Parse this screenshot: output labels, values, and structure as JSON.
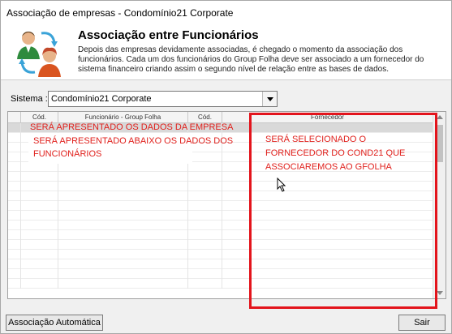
{
  "window": {
    "title": "Associação de empresas - Condomínio21 Corporate"
  },
  "header": {
    "title": "Associação entre Funcionários",
    "description": "Depois das empresas devidamente associadas, é chegado o momento da associação dos funcionários. Cada um dos funcionários do Group Folha deve ser associado a um fornecedor do sistema financeiro criando assim o segundo nível de relação entre as bases de dados."
  },
  "sistema": {
    "label": "Sistema :",
    "value": "Condomínio21 Corporate"
  },
  "grid": {
    "columns": [
      "",
      "Cód.",
      "Funcionário - Group Folha",
      "Cód.",
      "Fornecedor"
    ]
  },
  "annotations": {
    "empresa": "SERÁ APRESENTADO OS DADOS DA EMPRESA",
    "funcionarios_line1": "SERÁ APRESENTADO ABAIXO OS DADOS DOS",
    "funcionarios_line2": "FUNCIONÁRIOS",
    "fornecedor_line1": "SERÁ SELECIONADO O",
    "fornecedor_line2": "FORNECEDOR DO COND21 QUE",
    "fornecedor_line3": "ASSOCIAREMOS AO GFOLHA"
  },
  "buttons": {
    "auto": "Associação Automática",
    "sair": "Sair"
  },
  "colors": {
    "annotation": "#e3141c",
    "selected_row": "#d9d9d9"
  }
}
